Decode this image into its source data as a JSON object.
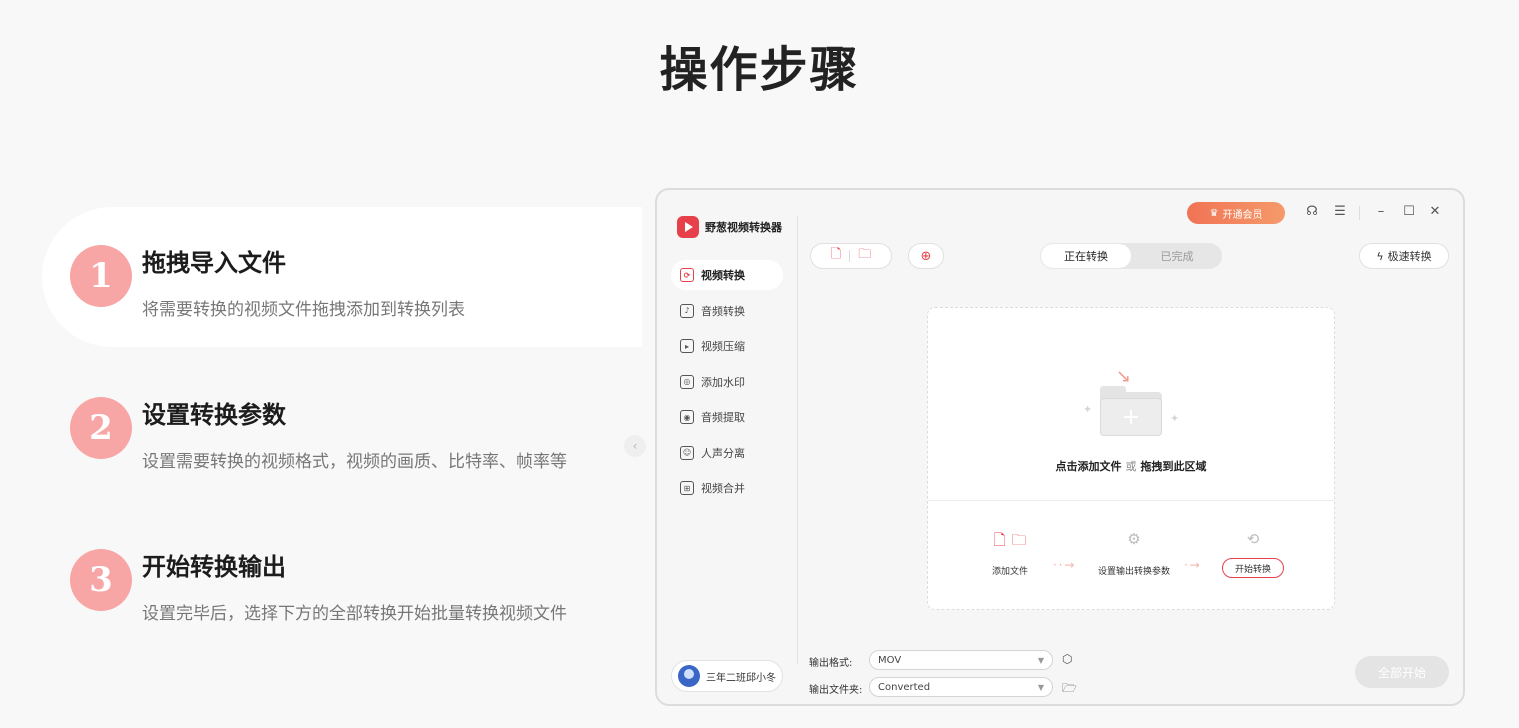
{
  "page": {
    "title": "操作步骤"
  },
  "steps": [
    {
      "num": "1",
      "title": "拖拽导入文件",
      "desc": "将需要转换的视频文件拖拽添加到转换列表"
    },
    {
      "num": "2",
      "title": "设置转换参数",
      "desc": "设置需要转换的视频格式，视频的画质、比特率、帧率等"
    },
    {
      "num": "3",
      "title": "开始转换输出",
      "desc": "设置完毕后，选择下方的全部转换开始批量转换视频文件"
    }
  ],
  "app": {
    "name": "野葱视频转换器",
    "vip_label": "开通会员",
    "nav": [
      {
        "label": "视频转换",
        "icon": "video-convert-icon"
      },
      {
        "label": "音频转换",
        "icon": "audio-convert-icon"
      },
      {
        "label": "视频压缩",
        "icon": "video-compress-icon"
      },
      {
        "label": "添加水印",
        "icon": "watermark-icon"
      },
      {
        "label": "音频提取",
        "icon": "audio-extract-icon"
      },
      {
        "label": "人声分离",
        "icon": "vocal-separate-icon"
      },
      {
        "label": "视频合并",
        "icon": "video-merge-icon"
      }
    ],
    "user_name": "三年二班邱小冬",
    "tabs": {
      "converting": "正在转换",
      "done": "已完成"
    },
    "speed_label": "极速转换",
    "drop": {
      "click_add": "点击添加文件",
      "or": "或",
      "drag_here": "拖拽到此区域",
      "flow_add": "添加文件",
      "flow_settings": "设置输出转换参数",
      "flow_start": "开始转换"
    },
    "output": {
      "format_label": "输出格式:",
      "format_value": "MOV",
      "folder_label": "输出文件夹:",
      "folder_value": "Converted"
    },
    "start_all": "全部开始",
    "colors": {
      "accent": "#e8404a",
      "step_badge": "#f7a5a5",
      "vip": "#f07355"
    }
  }
}
